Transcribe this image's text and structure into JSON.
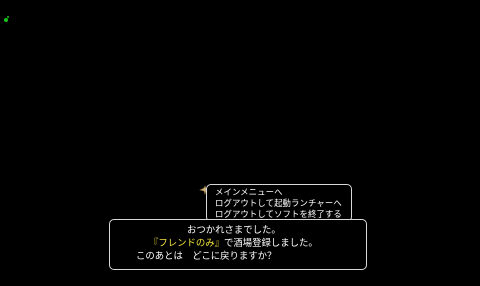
{
  "menu": {
    "cursor_icon": "hand-pointer-icon",
    "options": [
      {
        "label": "メインメニューへ"
      },
      {
        "label": "ログアウトして起動ランチャーへ"
      },
      {
        "label": "ログアウトしてソフトを終了する"
      }
    ]
  },
  "message": {
    "line1": "おつかれさまでした。",
    "line2_highlight": "『フレンドのみ』",
    "line2_rest": "で酒場登録しました。",
    "line3": "このあとは　どこに戻りますか？"
  },
  "colors": {
    "background": "#000000",
    "text": "#ffffff",
    "highlight": "#f4e23b",
    "border": "#d8d8d8",
    "indicator": "#19c21c"
  }
}
